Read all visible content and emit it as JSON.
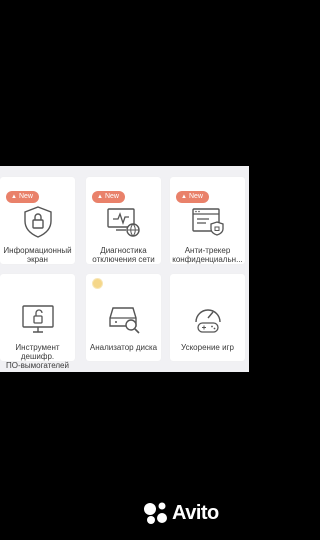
{
  "cards": [
    {
      "label": "Информационный\nэкран",
      "badge": "New",
      "icon": "shield-lock-icon"
    },
    {
      "label": "Диагностика\nотключения сети",
      "badge": "New",
      "icon": "network-diagnostics-icon"
    },
    {
      "label": "Анти-трекер\nконфиденциальн...",
      "badge": "New",
      "icon": "anti-tracker-icon"
    },
    {
      "label": "Инструмент\nдешифр.\nПО-вымогателей",
      "icon": "ransomware-decrypt-icon"
    },
    {
      "label": "Анализатор диска",
      "icon": "disk-analyzer-icon"
    },
    {
      "label": "Ускорение игр",
      "icon": "game-booster-icon"
    }
  ],
  "watermark": {
    "text": "Avito"
  },
  "colors": {
    "badge": "#e9816a",
    "card": "#ffffff",
    "panel": "#f1f1f4",
    "icon_stroke": "#555555"
  }
}
